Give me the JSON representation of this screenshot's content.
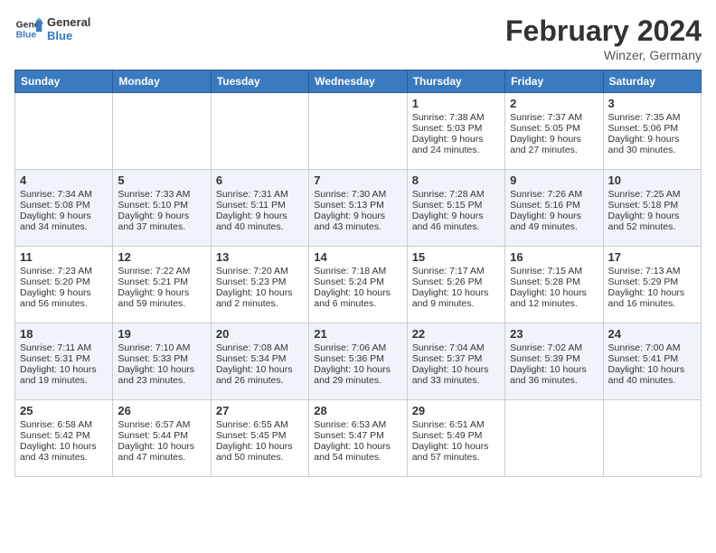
{
  "header": {
    "logo_line1": "General",
    "logo_line2": "Blue",
    "month_title": "February 2024",
    "location": "Winzer, Germany"
  },
  "days_of_week": [
    "Sunday",
    "Monday",
    "Tuesday",
    "Wednesday",
    "Thursday",
    "Friday",
    "Saturday"
  ],
  "weeks": [
    [
      {
        "day": "",
        "info": ""
      },
      {
        "day": "",
        "info": ""
      },
      {
        "day": "",
        "info": ""
      },
      {
        "day": "",
        "info": ""
      },
      {
        "day": "1",
        "info": "Sunrise: 7:38 AM\nSunset: 5:03 PM\nDaylight: 9 hours and 24 minutes."
      },
      {
        "day": "2",
        "info": "Sunrise: 7:37 AM\nSunset: 5:05 PM\nDaylight: 9 hours and 27 minutes."
      },
      {
        "day": "3",
        "info": "Sunrise: 7:35 AM\nSunset: 5:06 PM\nDaylight: 9 hours and 30 minutes."
      }
    ],
    [
      {
        "day": "4",
        "info": "Sunrise: 7:34 AM\nSunset: 5:08 PM\nDaylight: 9 hours and 34 minutes."
      },
      {
        "day": "5",
        "info": "Sunrise: 7:33 AM\nSunset: 5:10 PM\nDaylight: 9 hours and 37 minutes."
      },
      {
        "day": "6",
        "info": "Sunrise: 7:31 AM\nSunset: 5:11 PM\nDaylight: 9 hours and 40 minutes."
      },
      {
        "day": "7",
        "info": "Sunrise: 7:30 AM\nSunset: 5:13 PM\nDaylight: 9 hours and 43 minutes."
      },
      {
        "day": "8",
        "info": "Sunrise: 7:28 AM\nSunset: 5:15 PM\nDaylight: 9 hours and 46 minutes."
      },
      {
        "day": "9",
        "info": "Sunrise: 7:26 AM\nSunset: 5:16 PM\nDaylight: 9 hours and 49 minutes."
      },
      {
        "day": "10",
        "info": "Sunrise: 7:25 AM\nSunset: 5:18 PM\nDaylight: 9 hours and 52 minutes."
      }
    ],
    [
      {
        "day": "11",
        "info": "Sunrise: 7:23 AM\nSunset: 5:20 PM\nDaylight: 9 hours and 56 minutes."
      },
      {
        "day": "12",
        "info": "Sunrise: 7:22 AM\nSunset: 5:21 PM\nDaylight: 9 hours and 59 minutes."
      },
      {
        "day": "13",
        "info": "Sunrise: 7:20 AM\nSunset: 5:23 PM\nDaylight: 10 hours and 2 minutes."
      },
      {
        "day": "14",
        "info": "Sunrise: 7:18 AM\nSunset: 5:24 PM\nDaylight: 10 hours and 6 minutes."
      },
      {
        "day": "15",
        "info": "Sunrise: 7:17 AM\nSunset: 5:26 PM\nDaylight: 10 hours and 9 minutes."
      },
      {
        "day": "16",
        "info": "Sunrise: 7:15 AM\nSunset: 5:28 PM\nDaylight: 10 hours and 12 minutes."
      },
      {
        "day": "17",
        "info": "Sunrise: 7:13 AM\nSunset: 5:29 PM\nDaylight: 10 hours and 16 minutes."
      }
    ],
    [
      {
        "day": "18",
        "info": "Sunrise: 7:11 AM\nSunset: 5:31 PM\nDaylight: 10 hours and 19 minutes."
      },
      {
        "day": "19",
        "info": "Sunrise: 7:10 AM\nSunset: 5:33 PM\nDaylight: 10 hours and 23 minutes."
      },
      {
        "day": "20",
        "info": "Sunrise: 7:08 AM\nSunset: 5:34 PM\nDaylight: 10 hours and 26 minutes."
      },
      {
        "day": "21",
        "info": "Sunrise: 7:06 AM\nSunset: 5:36 PM\nDaylight: 10 hours and 29 minutes."
      },
      {
        "day": "22",
        "info": "Sunrise: 7:04 AM\nSunset: 5:37 PM\nDaylight: 10 hours and 33 minutes."
      },
      {
        "day": "23",
        "info": "Sunrise: 7:02 AM\nSunset: 5:39 PM\nDaylight: 10 hours and 36 minutes."
      },
      {
        "day": "24",
        "info": "Sunrise: 7:00 AM\nSunset: 5:41 PM\nDaylight: 10 hours and 40 minutes."
      }
    ],
    [
      {
        "day": "25",
        "info": "Sunrise: 6:58 AM\nSunset: 5:42 PM\nDaylight: 10 hours and 43 minutes."
      },
      {
        "day": "26",
        "info": "Sunrise: 6:57 AM\nSunset: 5:44 PM\nDaylight: 10 hours and 47 minutes."
      },
      {
        "day": "27",
        "info": "Sunrise: 6:55 AM\nSunset: 5:45 PM\nDaylight: 10 hours and 50 minutes."
      },
      {
        "day": "28",
        "info": "Sunrise: 6:53 AM\nSunset: 5:47 PM\nDaylight: 10 hours and 54 minutes."
      },
      {
        "day": "29",
        "info": "Sunrise: 6:51 AM\nSunset: 5:49 PM\nDaylight: 10 hours and 57 minutes."
      },
      {
        "day": "",
        "info": ""
      },
      {
        "day": "",
        "info": ""
      }
    ]
  ]
}
